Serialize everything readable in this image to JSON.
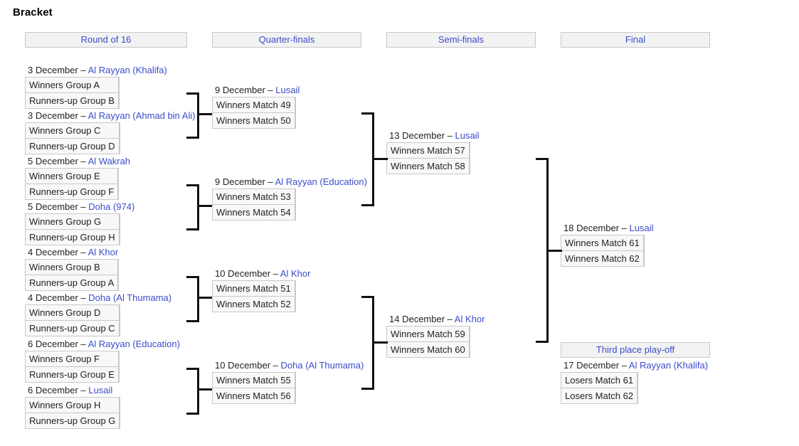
{
  "page": {
    "title": "Bracket"
  },
  "round_headers": [
    {
      "label": "Round of 16",
      "name": "round-header-round-of-16"
    },
    {
      "label": "Quarter-finals",
      "name": "round-header-quarter-finals"
    },
    {
      "label": "Semi-finals",
      "name": "round-header-semi-finals"
    },
    {
      "label": "Final",
      "name": "round-header-final"
    },
    {
      "label": "Third place play-off",
      "name": "round-header-third-place-playoff"
    }
  ],
  "colors": {
    "link": "#3b4cca",
    "header_bg": "#f2f2f2",
    "cell_bg": "#f8f8f8",
    "border": "#c8c8c8",
    "connector": "#111111",
    "text": "#202122"
  },
  "matches": {
    "r16_1": {
      "date": "3 December",
      "separator": " – ",
      "venue": "Al Rayyan (Khalifa)",
      "team1": "Winners Group A",
      "team2": "Runners-up Group B",
      "score1": "",
      "score2": ""
    },
    "r16_2": {
      "date": "3 December",
      "separator": " – ",
      "venue": "Al Rayyan (Ahmad bin Ali)",
      "team1": "Winners Group C",
      "team2": "Runners-up Group D",
      "score1": "",
      "score2": ""
    },
    "r16_3": {
      "date": "5 December",
      "separator": " – ",
      "venue": "Al Wakrah",
      "team1": "Winners Group E",
      "team2": "Runners-up Group F",
      "score1": "",
      "score2": ""
    },
    "r16_4": {
      "date": "5 December",
      "separator": " – ",
      "venue": "Doha (974)",
      "team1": "Winners Group G",
      "team2": "Runners-up Group H",
      "score1": "",
      "score2": ""
    },
    "r16_5": {
      "date": "4 December",
      "separator": " – ",
      "venue": "Al Khor",
      "team1": "Winners Group B",
      "team2": "Runners-up Group A",
      "score1": "",
      "score2": ""
    },
    "r16_6": {
      "date": "4 December",
      "separator": " – ",
      "venue": "Doha (Al Thumama)",
      "team1": "Winners Group D",
      "team2": "Runners-up Group C",
      "score1": "",
      "score2": ""
    },
    "r16_7": {
      "date": "6 December",
      "separator": " – ",
      "venue": "Al Rayyan (Education)",
      "team1": "Winners Group F",
      "team2": "Runners-up Group E",
      "score1": "",
      "score2": ""
    },
    "r16_8": {
      "date": "6 December",
      "separator": " – ",
      "venue": "Lusail",
      "team1": "Winners Group H",
      "team2": "Runners-up Group G",
      "score1": "",
      "score2": ""
    },
    "qf_1": {
      "date": "9 December",
      "separator": " – ",
      "venue": "Lusail",
      "team1": "Winners Match 49",
      "team2": "Winners Match 50",
      "score1": "",
      "score2": ""
    },
    "qf_2": {
      "date": "9 December",
      "separator": " – ",
      "venue": "Al Rayyan (Education)",
      "team1": "Winners Match 53",
      "team2": "Winners Match 54",
      "score1": "",
      "score2": ""
    },
    "qf_3": {
      "date": "10 December",
      "separator": " – ",
      "venue": "Al Khor",
      "team1": "Winners Match 51",
      "team2": "Winners Match 52",
      "score1": "",
      "score2": ""
    },
    "qf_4": {
      "date": "10 December",
      "separator": " – ",
      "venue": "Doha (Al Thumama)",
      "team1": "Winners Match 55",
      "team2": "Winners Match 56",
      "score1": "",
      "score2": ""
    },
    "sf_1": {
      "date": "13 December",
      "separator": " – ",
      "venue": "Lusail",
      "team1": "Winners Match 57",
      "team2": "Winners Match 58",
      "score1": "",
      "score2": ""
    },
    "sf_2": {
      "date": "14 December",
      "separator": " – ",
      "venue": "Al Khor",
      "team1": "Winners Match 59",
      "team2": "Winners Match 60",
      "score1": "",
      "score2": ""
    },
    "final": {
      "date": "18 December",
      "separator": " – ",
      "venue": "Lusail",
      "team1": "Winners Match 61",
      "team2": "Winners Match 62",
      "score1": "",
      "score2": ""
    },
    "third_place": {
      "date": "17 December",
      "separator": " – ",
      "venue": "Al Rayyan (Khalifa)",
      "team1": "Losers Match 61",
      "team2": "Losers Match 62",
      "score1": "",
      "score2": ""
    }
  }
}
